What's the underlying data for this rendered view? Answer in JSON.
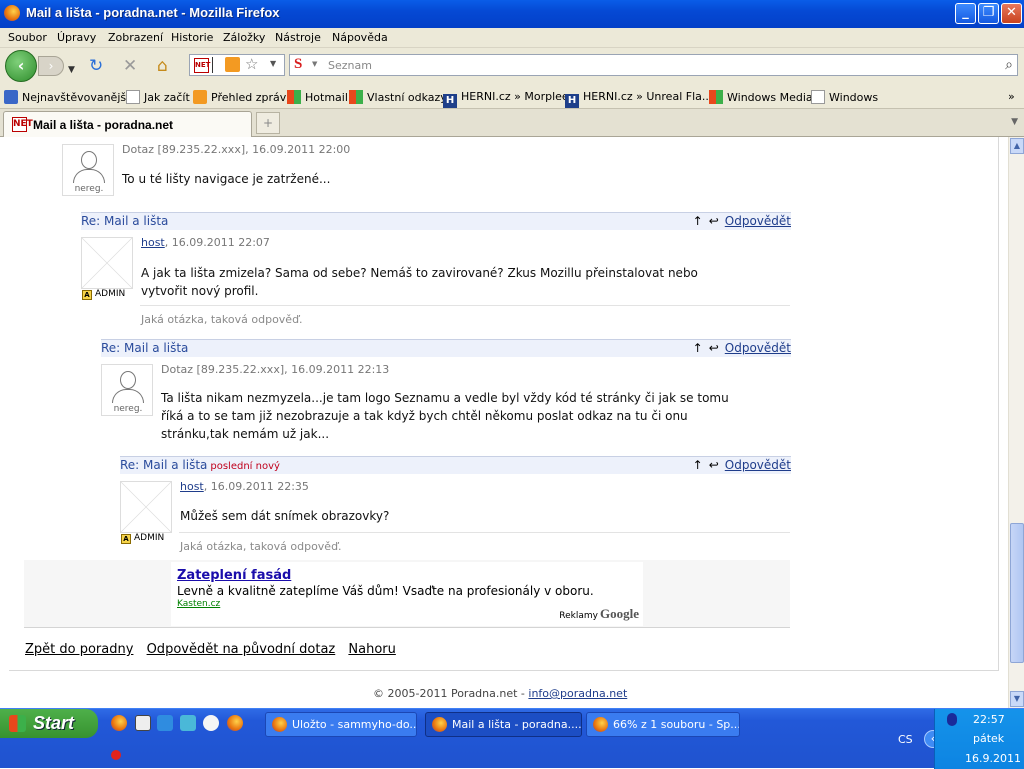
{
  "window": {
    "title": "Mail a lišta - poradna.net - Mozilla Firefox",
    "minimize": "_",
    "maximize": "❐",
    "close": "✕"
  },
  "menu": [
    "Soubor",
    "Úpravy",
    "Zobrazení",
    "Historie",
    "Záložky",
    "Nástroje",
    "Nápověda"
  ],
  "search": {
    "engine_icon": "S",
    "placeholder": "Seznam"
  },
  "bookmarks": {
    "items": [
      "Nejnavštěvovanější",
      "Jak začít",
      "Přehled zpráv",
      "Hotmail",
      "Vlastní odkazy",
      "HERNI.cz » Morplee",
      "HERNI.cz » Unreal Fla...",
      "Windows Media",
      "Windows"
    ],
    "more": "»"
  },
  "tab": {
    "title": "Mail a lišta - poradna.net",
    "favicon": "NET",
    "new_tab": "+"
  },
  "posts": {
    "p1": {
      "avatar_caption": "nereg.",
      "meta": "Dotaz [89.235.22.xxx], 16.09.2011 22:00",
      "text": "To u té lišty navigace je zatržené..."
    },
    "r1": {
      "title": "Re: Mail a lišta",
      "up": "↑",
      "back": "↩",
      "reply": "Odpovědět"
    },
    "p2": {
      "admin": "ADMIN",
      "author": "host",
      "date": ", 16.09.2011 22:07",
      "text1": "A jak ta lišta zmizela? Sama od sebe? Nemáš to zavirované? Zkus Mozillu přeinstalovat nebo",
      "text2": "vytvořit nový profil.",
      "signature": "Jaká otázka, taková odpověď."
    },
    "r2": {
      "title": "Re: Mail a lišta",
      "up": "↑",
      "back": "↩",
      "reply": "Odpovědět"
    },
    "p3": {
      "avatar_caption": "nereg.",
      "meta": "Dotaz [89.235.22.xxx], 16.09.2011 22:13",
      "text1": "Ta lišta nikam nezmyzela...je tam logo Seznamu a vedle byl vždy kód té stránky či jak se tomu",
      "text2": "říká a to se tam již nezobrazuje a tak když bych chtěl někomu poslat odkaz na tu či onu",
      "text3": "stránku,tak nemám už jak..."
    },
    "r3": {
      "title": "Re: Mail a lišta",
      "badge": "poslední nový",
      "up": "↑",
      "back": "↩",
      "reply": "Odpovědět"
    },
    "p4": {
      "admin": "ADMIN",
      "author": "host",
      "date": ", 16.09.2011 22:35",
      "text": "Můžeš sem dát snímek obrazovky?",
      "signature": "Jaká otázka, taková odpověď."
    }
  },
  "ad": {
    "title": "Zateplení fasád",
    "desc": "Levně a kvalitně zateplíme Váš dům! Vsaďte na profesionály v oboru.",
    "url": "Kasten.cz",
    "by": "Reklamy",
    "brand": "Google"
  },
  "footer_links": [
    "Zpět do poradny",
    "Odpovědět na původní dotaz",
    "Nahoru"
  ],
  "copyright": {
    "text": "© 2005-2011 Poradna.net - ",
    "email": "info@poradna.net"
  },
  "taskbar": {
    "start": "Start",
    "buttons": [
      "Uložto - sammyho-do...",
      "Mail a lišta - poradna....",
      "66% z 1 souboru - Sp..."
    ],
    "lang": "CS",
    "chevron": "‹",
    "time": "22:57",
    "day": "pátek",
    "date": "16.9.2011"
  }
}
